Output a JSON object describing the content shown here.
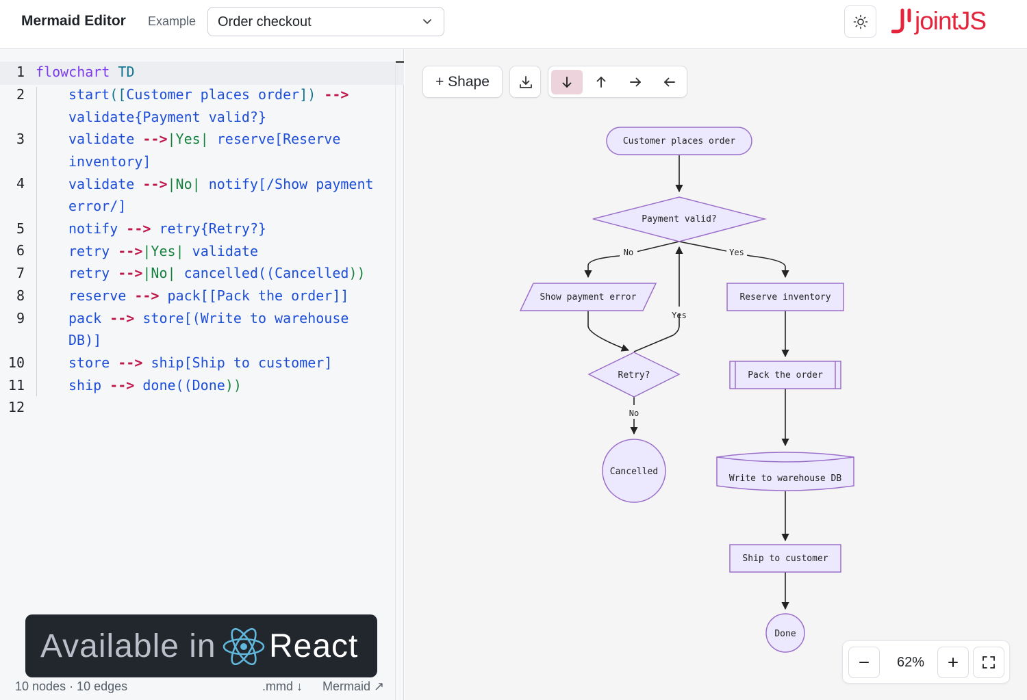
{
  "header": {
    "app_title": "Mermaid Editor",
    "example_label": "Example",
    "example_selected": "Order checkout",
    "logo_text": "jointJS",
    "theme_icon": "sun-icon"
  },
  "editor": {
    "line_numbers": [
      "1",
      "2",
      "3",
      "4",
      "5",
      "6",
      "7",
      "8",
      "9",
      "10",
      "11",
      "12"
    ],
    "code": [
      {
        "k": "flowchart",
        "td": "TD"
      },
      {
        "a": "start",
        "b": "([",
        "c": "Customer places order",
        "d": "])",
        "e": "-->"
      },
      {
        "a": "validate{",
        "c": "Payment valid",
        "d": "?}"
      },
      {
        "a": "validate",
        "e": "-->",
        "l": "|Yes|",
        "f": "reserve[",
        "c": "Reserve"
      },
      {
        "c": "inventory",
        "d": "]"
      },
      {
        "a": "validate",
        "e": "-->",
        "l": "|No|",
        "f": "notify[/",
        "c": "Show payment"
      },
      {
        "c": "error",
        "d": "/]"
      },
      {
        "a": "notify",
        "e": "-->",
        "f": "retry{",
        "c": "Retry",
        "d": "?}"
      },
      {
        "a": "retry",
        "e": "-->",
        "l": "|Yes|",
        "f": "validate"
      },
      {
        "a": "retry",
        "e": "-->",
        "l": "|No|",
        "f": "cancelled((",
        "c": "Cancelled",
        "d": "))"
      },
      {
        "a": "reserve",
        "e": "-->",
        "f": "pack[[",
        "c": "Pack the order",
        "d": "]]"
      },
      {
        "a": "pack",
        "e": "-->",
        "f": "store[(",
        "c": "Write to warehouse"
      },
      {
        "c": "DB",
        "d": ")]"
      },
      {
        "a": "store",
        "e": "-->",
        "f": "ship[",
        "c": "Ship to customer",
        "d": "]"
      },
      {
        "a": "ship",
        "e": "-->",
        "f": "done((",
        "c": "Done",
        "d": "))"
      }
    ],
    "banner_prefix": "Available in",
    "banner_react": "React",
    "status_counts": "10 nodes · 10 edges",
    "export_mmd": ".mmd ↓",
    "mermaid_link": "Mermaid ↗"
  },
  "toolbar": {
    "shape_label": "+ Shape",
    "download_icon": "download-icon",
    "directions": [
      "arrow-down-icon",
      "arrow-up-icon",
      "arrow-right-icon",
      "arrow-left-icon"
    ],
    "active_direction": "arrow-down-icon"
  },
  "diagram": {
    "nodes": {
      "start": "Customer places order",
      "validate": "Payment valid?",
      "notify": "Show payment error",
      "reserve": "Reserve inventory",
      "retry": "Retry?",
      "pack": "Pack the order",
      "cancelled": "Cancelled",
      "store": "Write to warehouse DB",
      "ship": "Ship to customer",
      "done": "Done"
    },
    "edge_labels": {
      "no": "No",
      "yes": "Yes",
      "retry_yes": "Yes",
      "retry_no": "No"
    },
    "node_fill": "#ece8fd",
    "node_stroke": "#9b6fc9"
  },
  "zoom": {
    "level": "62%",
    "minus": "−",
    "plus": "+"
  }
}
